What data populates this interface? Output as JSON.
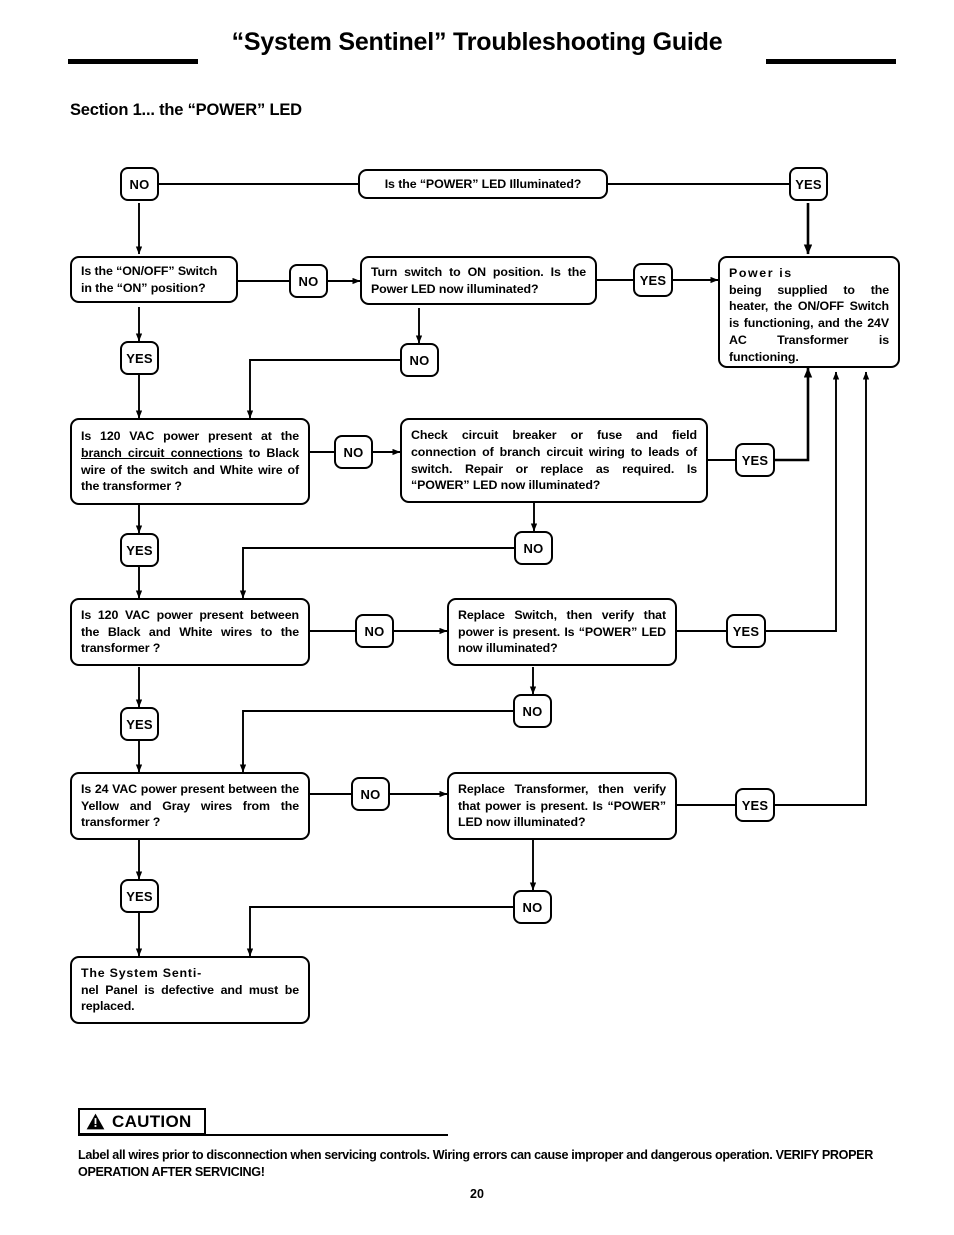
{
  "header": {
    "title": "“System Sentinel” Troubleshooting Guide",
    "section_title": "Section 1... the “POWER” LED"
  },
  "flow": {
    "q_power_led": "Is the “POWER” LED Illuminated?",
    "q_onoff_switch": "Is the “ON/OFF” Switch in the “ON” position?",
    "a_turn_switch_on": "Turn switch to ON position. Is the Power LED now illuminated?",
    "result_power_ok_head": "Power   is",
    "result_power_ok_body": "being supplied to the heater, the ON/OFF Switch is functioning, and the 24V AC Transformer is functioning.",
    "q_120vac_branch_pre": "Is 120 VAC power present at the ",
    "q_120vac_branch_underlined": "branch circuit connections",
    "q_120vac_branch_post": " to Black wire of the switch and White wire of the transformer ?",
    "a_check_breaker": "Check circuit breaker or fuse and field connection of branch circuit wiring to leads of switch. Repair or replace as required. Is “POWER” LED now illuminated?",
    "q_120vac_black_white": "Is 120 VAC power present between the Black and White wires to the transformer ?",
    "a_replace_switch": "Replace Switch, then verify that power is present. Is “POWER” LED now illuminated?",
    "q_24vac_yellow_gray": "Is 24 VAC power present between the Yellow and Gray wires from the transformer ?",
    "a_replace_transformer": "Replace Transformer, then verify that power is present. Is “POWER” LED now illuminated?",
    "result_panel_defective_head": "The   System   Senti-",
    "result_panel_defective_body": "nel Panel is defective and must be replaced.",
    "labels": {
      "no": "NO",
      "yes": "YES"
    }
  },
  "footer": {
    "caution_label": "CAUTION",
    "caution_icon": "warning-triangle-icon",
    "caution_text": "Label all wires prior to disconnection when servicing controls. Wiring errors can cause improper and dangerous operation.   VERIFY PROPER OPERATION AFTER SERVICING!",
    "page_number": "20"
  },
  "colors": {
    "ink": "#000000",
    "paper": "#ffffff"
  }
}
